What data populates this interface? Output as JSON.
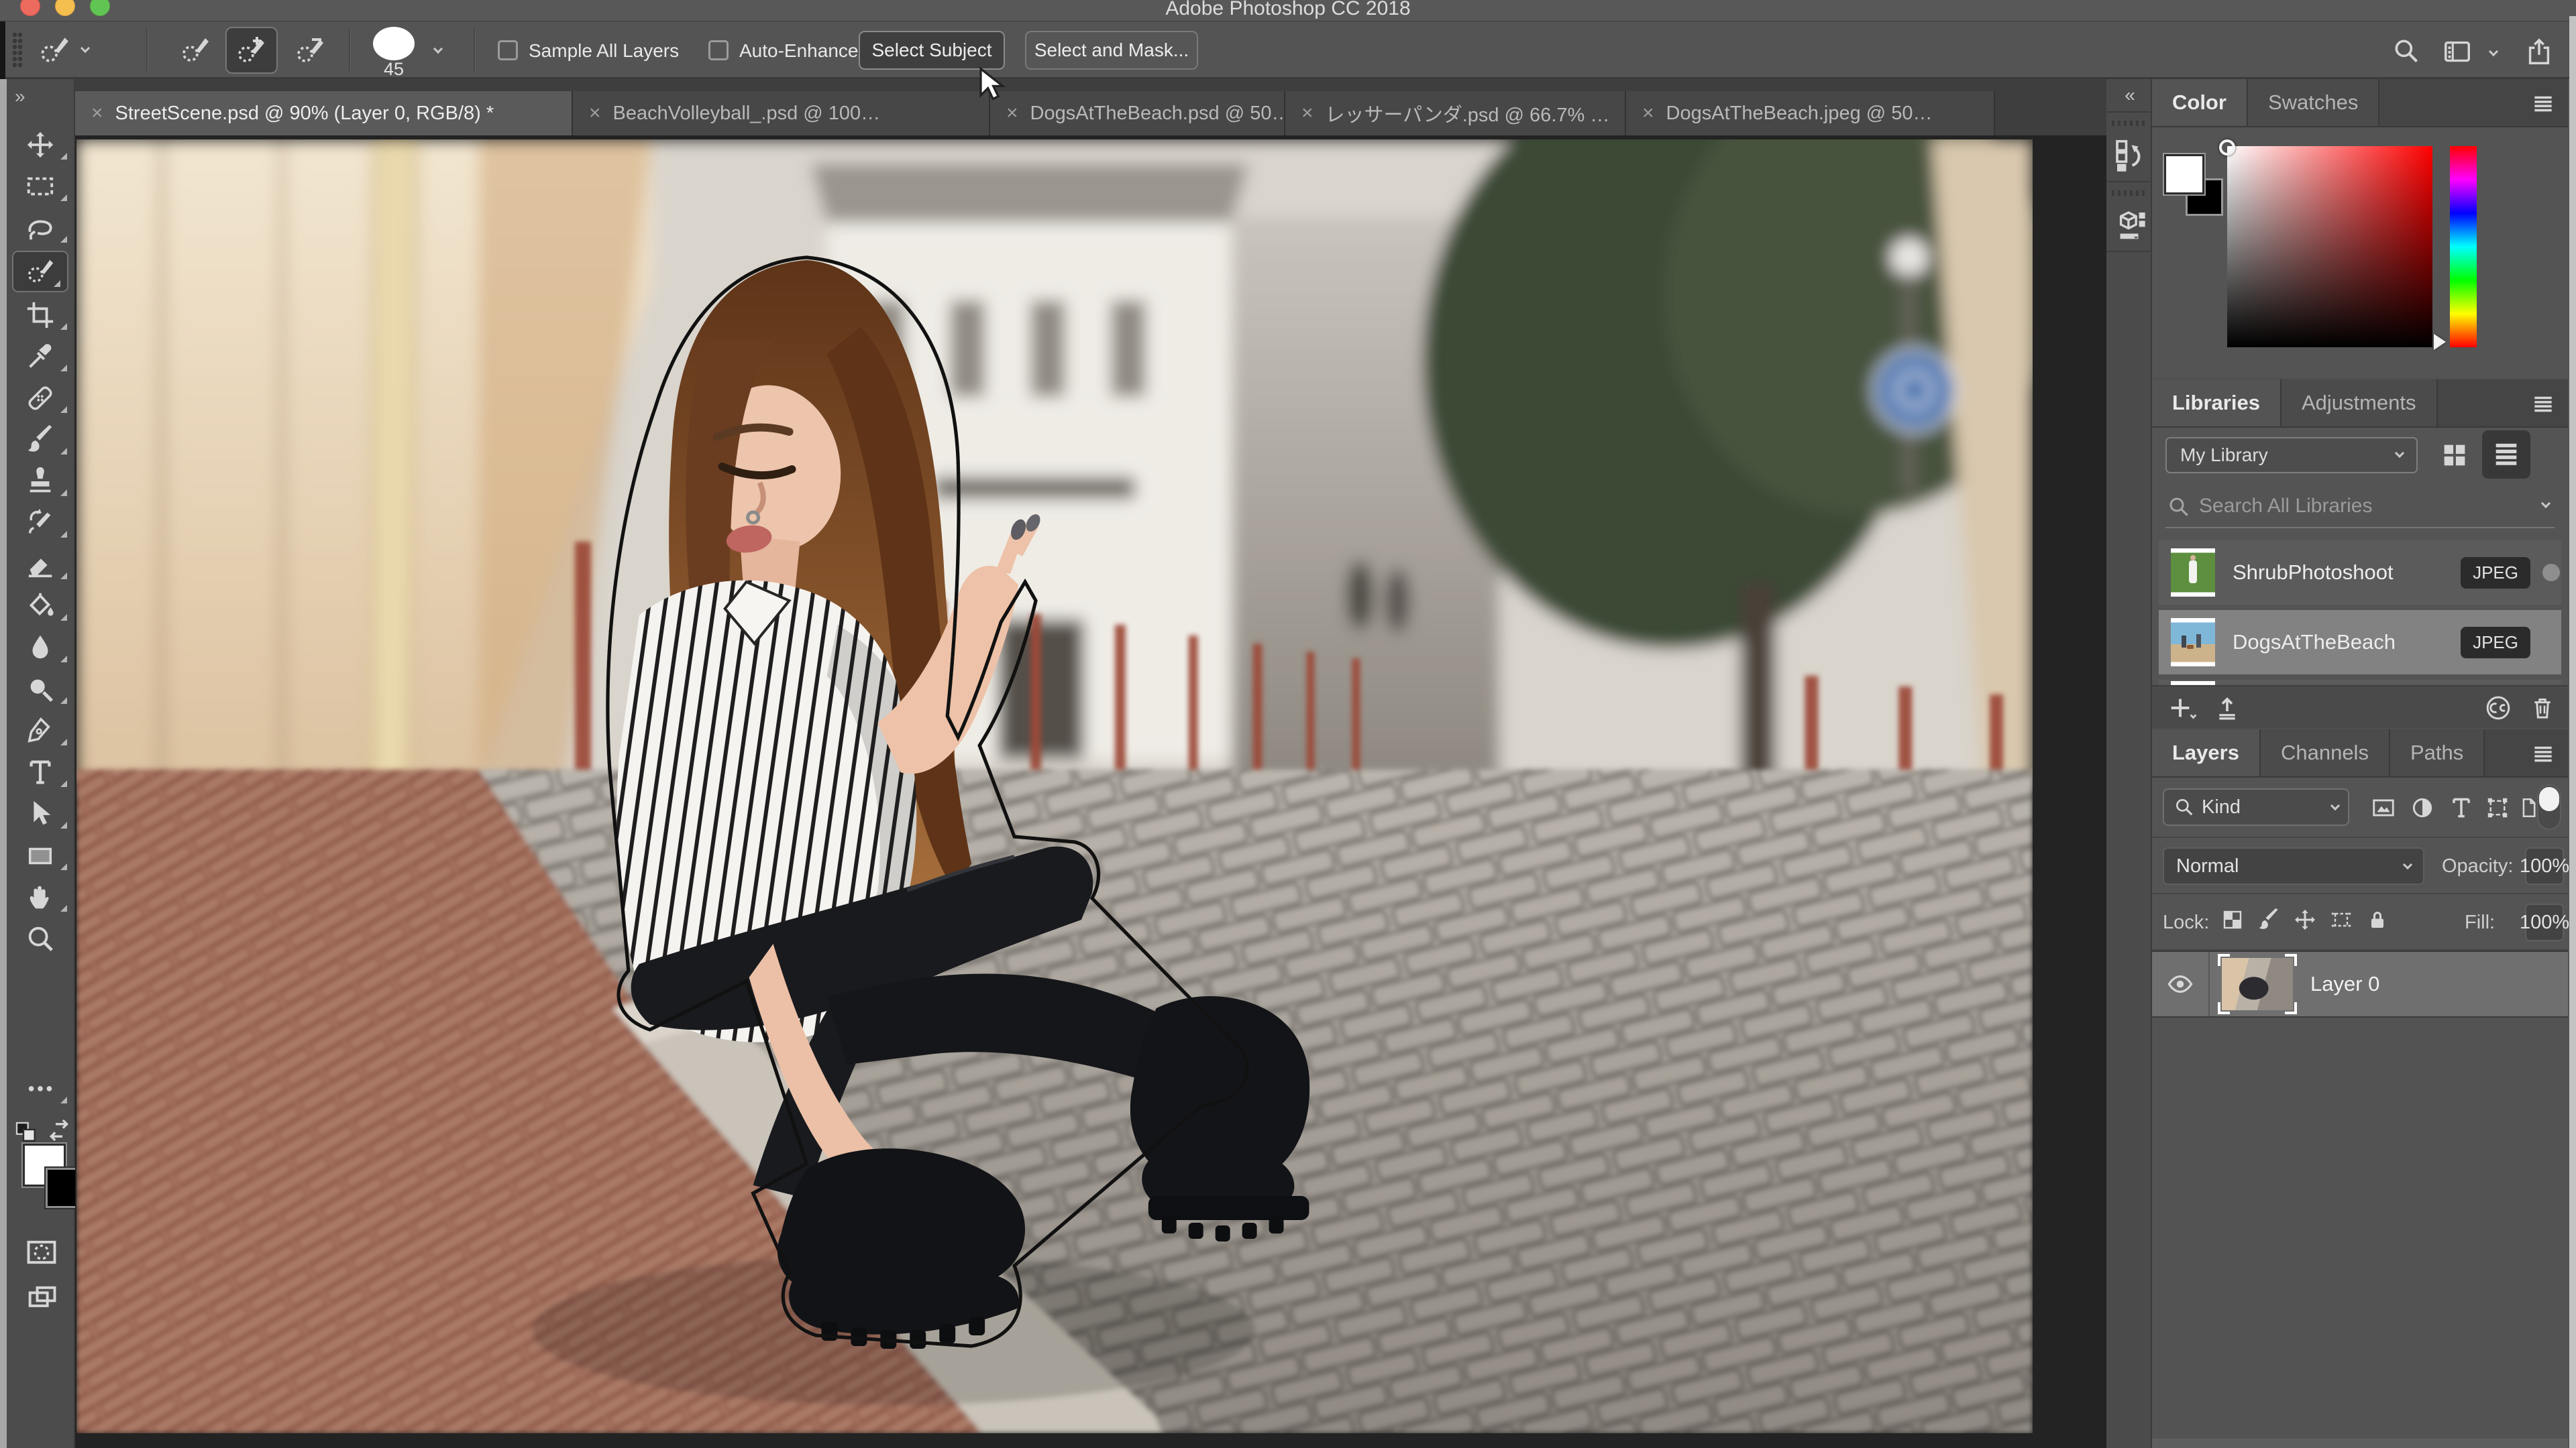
{
  "window": {
    "title": "Adobe Photoshop CC 2018"
  },
  "glyphs": {
    "close": "×",
    "collapse_right_panels": "«",
    "expand_toolbar": "»"
  },
  "colors": {
    "chrome": "#545454",
    "panel_dark": "#454545",
    "canvas_bg": "#232323",
    "active_tab": "#5a5a5a",
    "inactive_tab": "#474747",
    "selected_layer_row": "#6f6f6f",
    "selected_library_row": "#828282",
    "badge_bg": "#2b2b2b"
  },
  "options_bar": {
    "brush_size": "45",
    "sample_all_layers": "Sample All Layers",
    "auto_enhance": "Auto-Enhance",
    "select_subject": "Select Subject",
    "select_and_mask": "Select and Mask...",
    "sample_all_layers_checked": false,
    "auto_enhance_checked": false
  },
  "document_tabs": {
    "items": [
      {
        "label": "StreetScene.psd @ 90% (Layer 0, RGB/8) *",
        "active": true
      },
      {
        "label": "BeachVolleyball_.psd @ 100…",
        "active": false
      },
      {
        "label": "DogsAtTheBeach.psd @ 50…",
        "active": false
      },
      {
        "label": "レッサーパンダ.psd @ 66.7% …",
        "active": false
      },
      {
        "label": "DogsAtTheBeach.jpeg @ 50…",
        "active": false
      }
    ]
  },
  "toolbar": {
    "tools": [
      "move",
      "rectangular-marquee",
      "lasso",
      "quick-selection",
      "crop",
      "eyedropper",
      "spot-healing-brush",
      "brush",
      "clone-stamp",
      "history-brush",
      "eraser",
      "gradient",
      "blur",
      "dodge",
      "pen",
      "type",
      "path-selection",
      "rectangle",
      "hand",
      "zoom"
    ],
    "active_tool": "quick-selection"
  },
  "color_panel": {
    "tab_color": "Color",
    "tab_swatches": "Swatches"
  },
  "libraries_panel": {
    "tab_libraries": "Libraries",
    "tab_adjustments": "Adjustments",
    "library_name": "My Library",
    "search_placeholder": "Search All Libraries",
    "items": [
      {
        "name": "ShrubPhotoshoot",
        "type": "JPEG",
        "selected": false
      },
      {
        "name": "DogsAtTheBeach",
        "type": "JPEG",
        "selected": true
      }
    ]
  },
  "layers_panel": {
    "tab_layers": "Layers",
    "tab_channels": "Channels",
    "tab_paths": "Paths",
    "filter_kind": "Kind",
    "blend_mode": "Normal",
    "opacity_label": "Opacity:",
    "opacity_value": "100%",
    "lock_label": "Lock:",
    "fill_label": "Fill:",
    "fill_value": "100%",
    "layers": [
      {
        "name": "Layer 0",
        "visible": true,
        "selected": true
      }
    ]
  }
}
